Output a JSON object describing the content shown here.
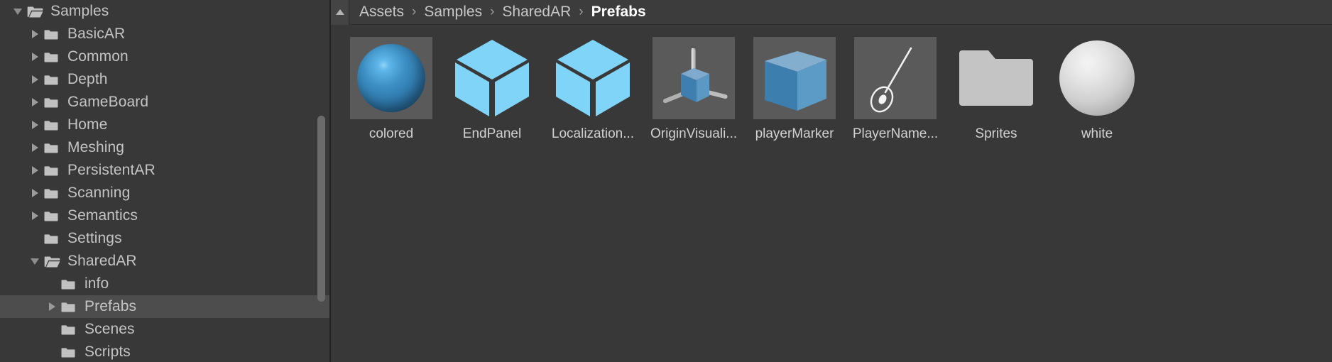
{
  "window": {
    "app": "Unity Editor Project Browser",
    "background_color": "#383838",
    "panel_color": "#3c3c3c",
    "selection_color": "#4d4d4d",
    "text_color": "#c8c8c8",
    "prefab_accent_color": "#7fd4f7",
    "folder_icon_color": "#c0c0c0"
  },
  "sidebar": {
    "name": "project-tree",
    "scrollbar": {
      "name": "vertical-scrollbar",
      "visible": true
    },
    "items": [
      {
        "label": "Samples",
        "indent": 0,
        "twisty": "down",
        "folder": "open",
        "selected": false
      },
      {
        "label": "BasicAR",
        "indent": 1,
        "twisty": "right",
        "folder": "closed",
        "selected": false
      },
      {
        "label": "Common",
        "indent": 1,
        "twisty": "right",
        "folder": "closed",
        "selected": false
      },
      {
        "label": "Depth",
        "indent": 1,
        "twisty": "right",
        "folder": "closed",
        "selected": false
      },
      {
        "label": "GameBoard",
        "indent": 1,
        "twisty": "right",
        "folder": "closed",
        "selected": false
      },
      {
        "label": "Home",
        "indent": 1,
        "twisty": "right",
        "folder": "closed",
        "selected": false
      },
      {
        "label": "Meshing",
        "indent": 1,
        "twisty": "right",
        "folder": "closed",
        "selected": false
      },
      {
        "label": "PersistentAR",
        "indent": 1,
        "twisty": "right",
        "folder": "closed",
        "selected": false
      },
      {
        "label": "Scanning",
        "indent": 1,
        "twisty": "right",
        "folder": "closed",
        "selected": false
      },
      {
        "label": "Semantics",
        "indent": 1,
        "twisty": "right",
        "folder": "closed",
        "selected": false
      },
      {
        "label": "Settings",
        "indent": 1,
        "twisty": "none",
        "folder": "closed",
        "selected": false
      },
      {
        "label": "SharedAR",
        "indent": 1,
        "twisty": "down",
        "folder": "open",
        "selected": false
      },
      {
        "label": "info",
        "indent": 2,
        "twisty": "none",
        "folder": "closed",
        "selected": false
      },
      {
        "label": "Prefabs",
        "indent": 2,
        "twisty": "right",
        "folder": "closed",
        "selected": true
      },
      {
        "label": "Scenes",
        "indent": 2,
        "twisty": "none",
        "folder": "closed",
        "selected": false
      },
      {
        "label": "Scripts",
        "indent": 2,
        "twisty": "none",
        "folder": "closed",
        "selected": false
      }
    ]
  },
  "breadcrumb": {
    "name": "breadcrumb-path",
    "separator": "›",
    "collapse_button": "collapse-panel-button",
    "segments": [
      {
        "label": "Assets",
        "active": false
      },
      {
        "label": "Samples",
        "active": false
      },
      {
        "label": "SharedAR",
        "active": false
      },
      {
        "label": "Prefabs",
        "active": true
      }
    ]
  },
  "assets": {
    "name": "asset-grid",
    "items": [
      {
        "label": "colored",
        "icon": "sphere-blue",
        "tile": true
      },
      {
        "label": "EndPanel",
        "icon": "prefab-cube",
        "tile": false
      },
      {
        "label": "Localization...",
        "icon": "prefab-cube",
        "tile": false
      },
      {
        "label": "OriginVisuali...",
        "icon": "axis-cube",
        "tile": true
      },
      {
        "label": "playerMarker",
        "icon": "solid-cube",
        "tile": true
      },
      {
        "label": "PlayerName...",
        "icon": "needle-pin",
        "tile": true
      },
      {
        "label": "Sprites",
        "icon": "folder",
        "tile": false
      },
      {
        "label": "white",
        "icon": "sphere-white",
        "tile": false
      }
    ]
  }
}
